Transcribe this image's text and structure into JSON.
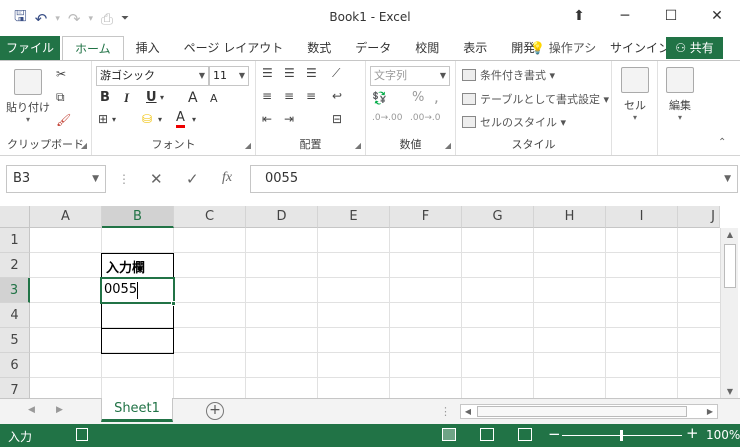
{
  "window": {
    "title": "Book1 - Excel",
    "icons": [
      "save-icon",
      "undo-icon",
      "redo-icon",
      "print-preview-icon",
      "customize-qat-icon"
    ]
  },
  "ribbon_tabs": {
    "file": "ファイル",
    "tabs": [
      "ホーム",
      "挿入",
      "ページ レイアウト",
      "数式",
      "データ",
      "校閲",
      "表示",
      "開発"
    ],
    "active": "ホーム",
    "tell_me": "操作アシ",
    "sign_in": "サインイン",
    "share": "共有"
  },
  "ribbon": {
    "clipboard": {
      "label": "クリップボード",
      "paste": "貼り付け"
    },
    "font": {
      "label": "フォント",
      "font_name": "游ゴシック",
      "font_size": "11",
      "bold": "B",
      "italic": "I",
      "underline": "U",
      "grow": "A",
      "shrink": "A",
      "color": "A"
    },
    "alignment": {
      "label": "配置"
    },
    "number": {
      "label": "数値",
      "format": "文字列",
      "percent": "%",
      "comma": ","
    },
    "styles": {
      "label": "スタイル",
      "conditional": "条件付き書式",
      "table": "テーブルとして書式設定",
      "cell_styles": "セルのスタイル"
    },
    "cells": {
      "label": "セル"
    },
    "editing": {
      "label": "編集"
    }
  },
  "formula_bar": {
    "name_box": "B3",
    "cancel": "✕",
    "enter": "✓",
    "fx": "fx",
    "content": "0055"
  },
  "grid": {
    "columns": [
      "A",
      "B",
      "C",
      "D",
      "E",
      "F",
      "G",
      "H",
      "I",
      "J"
    ],
    "rows": [
      "1",
      "2",
      "3",
      "4",
      "5",
      "6",
      "7"
    ],
    "selected_column": "B",
    "selected_row": "3",
    "cells": {
      "B2": "入力欄",
      "B3": "0055"
    }
  },
  "sheets": {
    "tabs": [
      "Sheet1"
    ],
    "add": "+"
  },
  "status": {
    "mode": "入力",
    "zoom": "100%"
  }
}
